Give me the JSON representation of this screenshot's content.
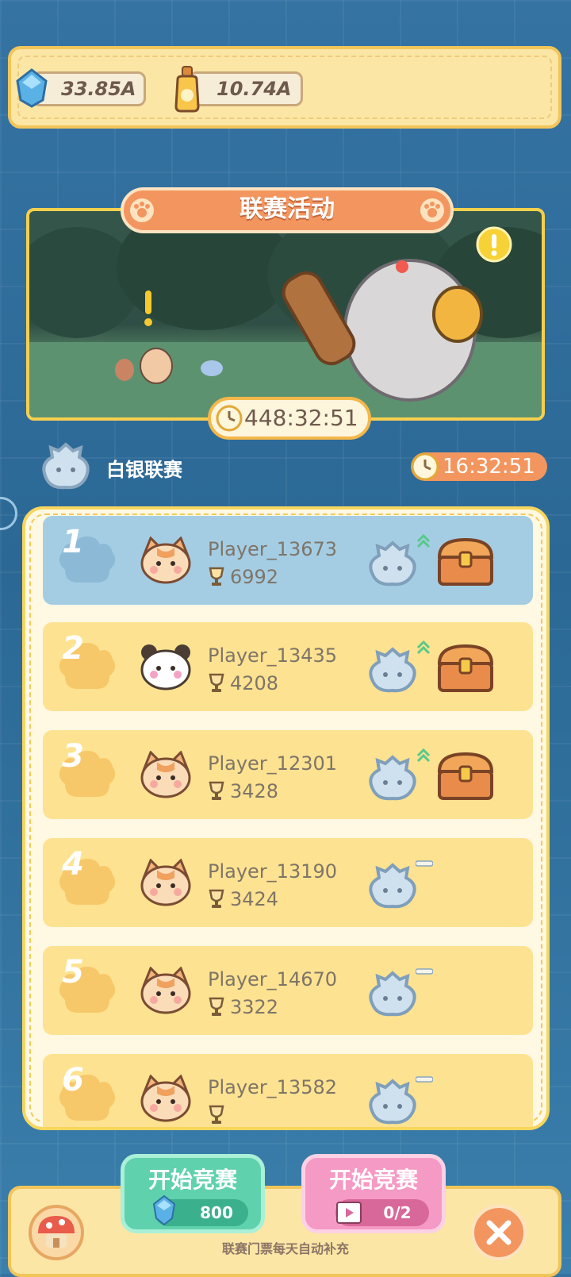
{
  "currency": {
    "gems": "33.85A",
    "potion": "10.74A"
  },
  "event": {
    "title": "联赛活动",
    "timer": "448:32:51"
  },
  "league": {
    "name": "白银联赛",
    "timer": "16:32:51"
  },
  "leaderboard": [
    {
      "rank": "1",
      "name": "Player_13673",
      "score": "6992",
      "avatar": "cat-face",
      "trend": "up",
      "chest": true
    },
    {
      "rank": "2",
      "name": "Player_13435",
      "score": "4208",
      "avatar": "panda-face",
      "trend": "up",
      "chest": true
    },
    {
      "rank": "3",
      "name": "Player_12301",
      "score": "3428",
      "avatar": "cat-face",
      "trend": "up",
      "chest": true
    },
    {
      "rank": "4",
      "name": "Player_13190",
      "score": "3424",
      "avatar": "cat-face",
      "trend": "same",
      "chest": false
    },
    {
      "rank": "5",
      "name": "Player_14670",
      "score": "3322",
      "avatar": "cat-face",
      "trend": "same",
      "chest": false
    },
    {
      "rank": "6",
      "name": "Player_13582",
      "score": "",
      "avatar": "cat-face",
      "trend": "same",
      "chest": false
    }
  ],
  "buttons": {
    "start_gem": {
      "label": "开始竞赛",
      "cost": "800"
    },
    "start_ad": {
      "label": "开始竞赛",
      "count": "0/2"
    }
  },
  "hint": "联赛门票每天自动补充",
  "colors": {
    "row_highlight": "#a4cde4",
    "row": "#fde291",
    "accent": "#f3955e"
  }
}
